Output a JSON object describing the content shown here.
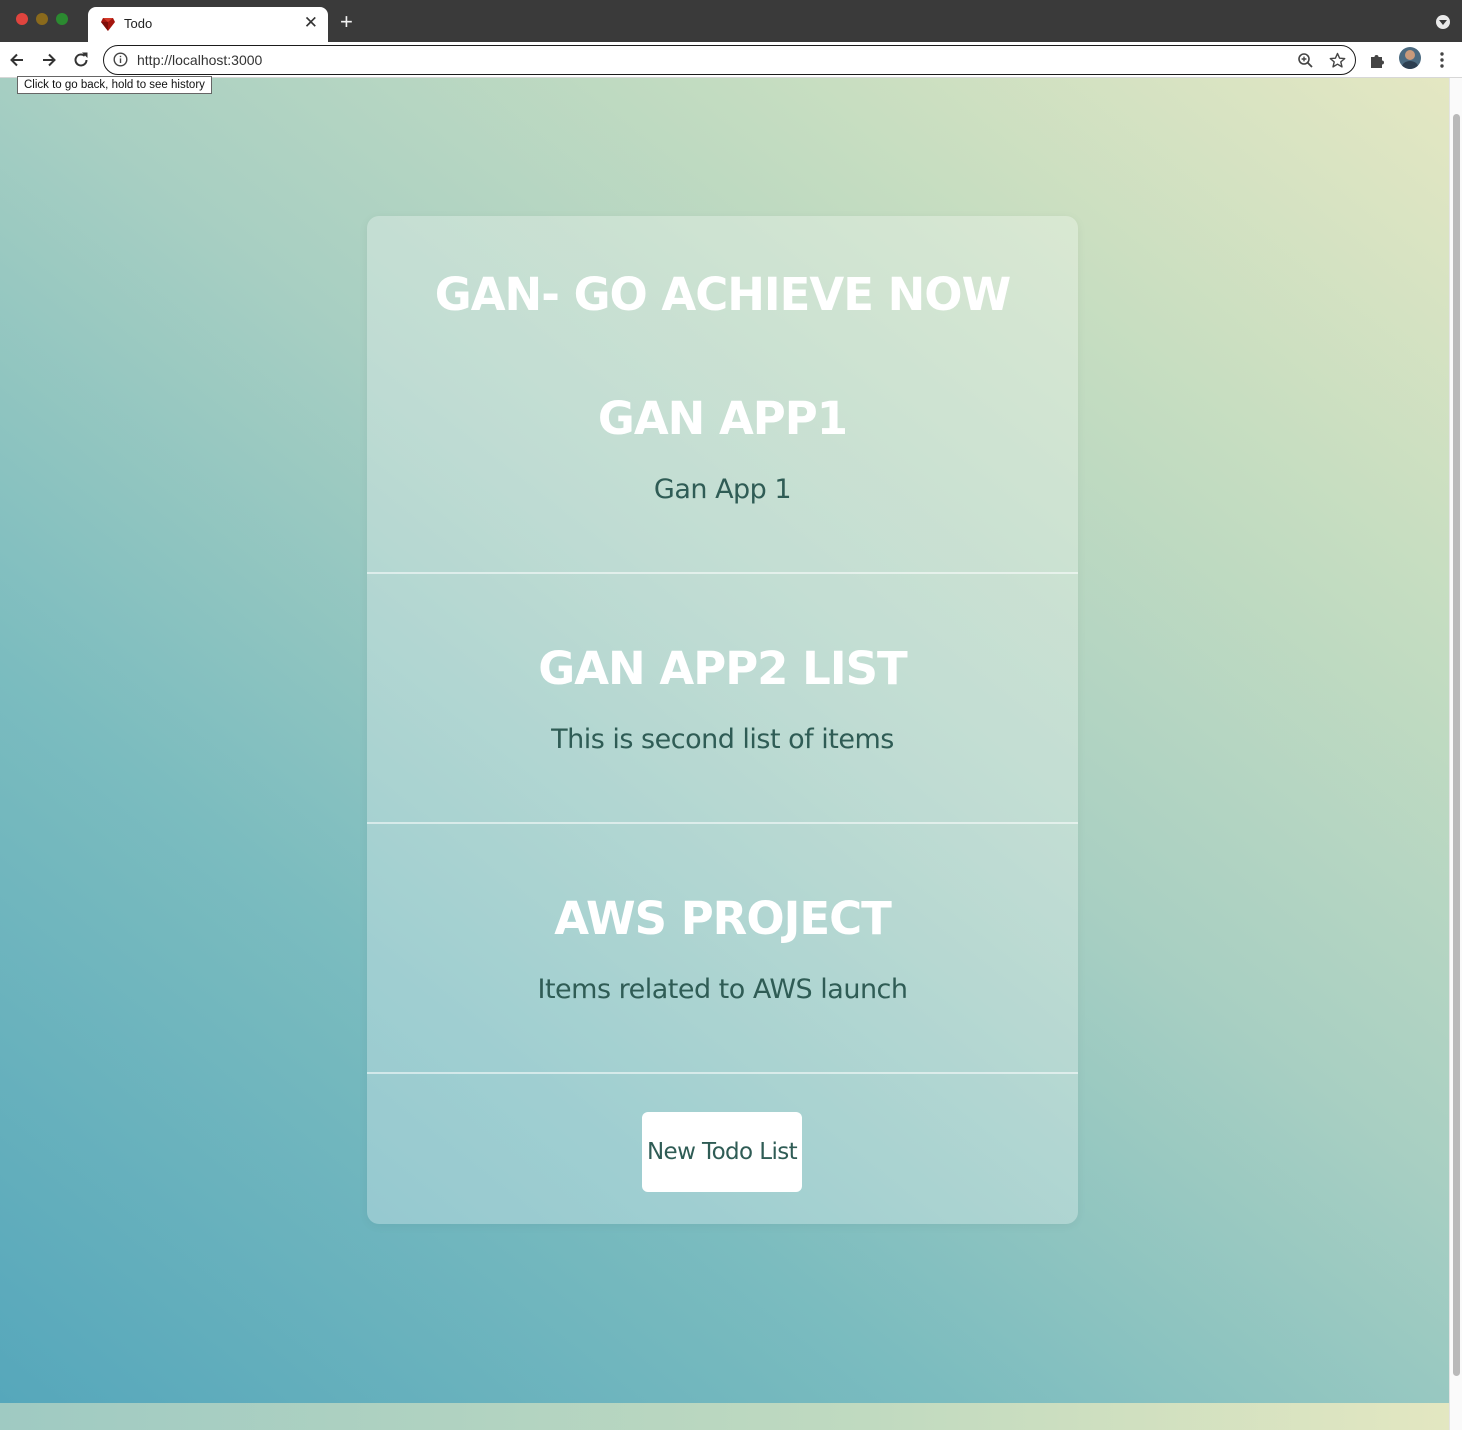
{
  "browser": {
    "tab_title": "Todo",
    "new_tab_label": "+",
    "close_label": "✕",
    "url": "http://localhost:3000",
    "back_tooltip": "Click to go back, hold to see history"
  },
  "page": {
    "app_title": "GAN- GO ACHIEVE NOW",
    "lists": [
      {
        "name": "GAN APP1",
        "description": "Gan App 1"
      },
      {
        "name": "GAN APP2 LIST",
        "description": "This is second list of items"
      },
      {
        "name": "AWS PROJECT",
        "description": "Items related to AWS launch"
      }
    ],
    "new_list_button": "New Todo List"
  },
  "colors": {
    "heading": "#ffffff",
    "description_text": "#2f5c55",
    "button_background": "#ffffff",
    "gradient_start": "#56a7bb",
    "gradient_end": "#e4e7c2"
  }
}
